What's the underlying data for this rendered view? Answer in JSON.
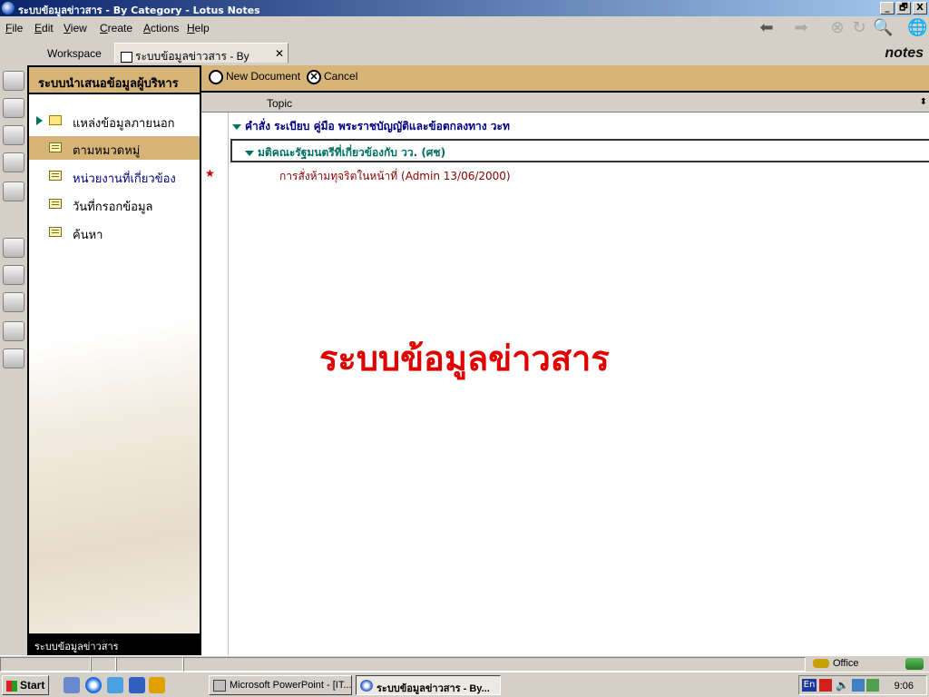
{
  "window": {
    "title": "ระบบข้อมูลข่าวสาร - By Category - Lotus Notes",
    "controls": [
      "_",
      "🗗",
      "X"
    ]
  },
  "menu": [
    {
      "key": "F",
      "rest": "ile"
    },
    {
      "key": "E",
      "rest": "dit"
    },
    {
      "key": "V",
      "rest": "iew"
    },
    {
      "key": "C",
      "rest": "reate"
    },
    {
      "key": "A",
      "rest": "ctions"
    },
    {
      "key": "H",
      "rest": "elp"
    }
  ],
  "tabs": {
    "workspace": "Workspace",
    "active": "ระบบข้อมูลข่าวสาร - By Category",
    "close_glyph": "✕"
  },
  "brand": "notes",
  "nav": {
    "header": "ระบบนำเสนอข้อมูลผู้บริหาร",
    "items": [
      {
        "label": "แหล่งข้อมูลภายนอก",
        "icon": "folder-icon"
      },
      {
        "label": "ตามหมวดหมู่",
        "icon": "view-icon"
      },
      {
        "label": "หน่วยงานที่เกี่ยวข้อง",
        "icon": "view-icon"
      },
      {
        "label": "วันที่กรอกข้อมูล",
        "icon": "view-icon"
      },
      {
        "label": "ค้นหา",
        "icon": "view-icon"
      }
    ],
    "footer": "ระบบข้อมูลข่าวสาร"
  },
  "actions": {
    "new_document": "New Document",
    "cancel": "Cancel"
  },
  "view": {
    "column_header": "Topic",
    "category_1": "คำสั่ง ระเบียบ คู่มือ พระราชบัญญัติและข้อตกลงทาง วะท",
    "category_2": "มติคณะรัฐมนตรีที่เกี่ยวข้องกับ วว. (ศช)",
    "document": "การสั่งห้ามทุจริตในหน้าที่ (Admin 13/06/2000)",
    "unread_mark": "★",
    "watermark": "ระบบข้อมูลข่าวสาร"
  },
  "status": {
    "location": "Office"
  },
  "taskbar": {
    "start": "Start",
    "tasks": [
      {
        "label": "Microsoft PowerPoint - [IT...",
        "active": false
      },
      {
        "label": "ระบบข้อมูลข่าวสาร - By...",
        "active": true
      }
    ],
    "tray_lang": "En",
    "clock": "9:06"
  },
  "colors": {
    "titlebar": "#0a246a",
    "accent_tan": "#d6b478",
    "category_text": "#000080",
    "subcategory_text": "#007060",
    "doc_text": "#8b0000",
    "watermark": "#e00000"
  }
}
